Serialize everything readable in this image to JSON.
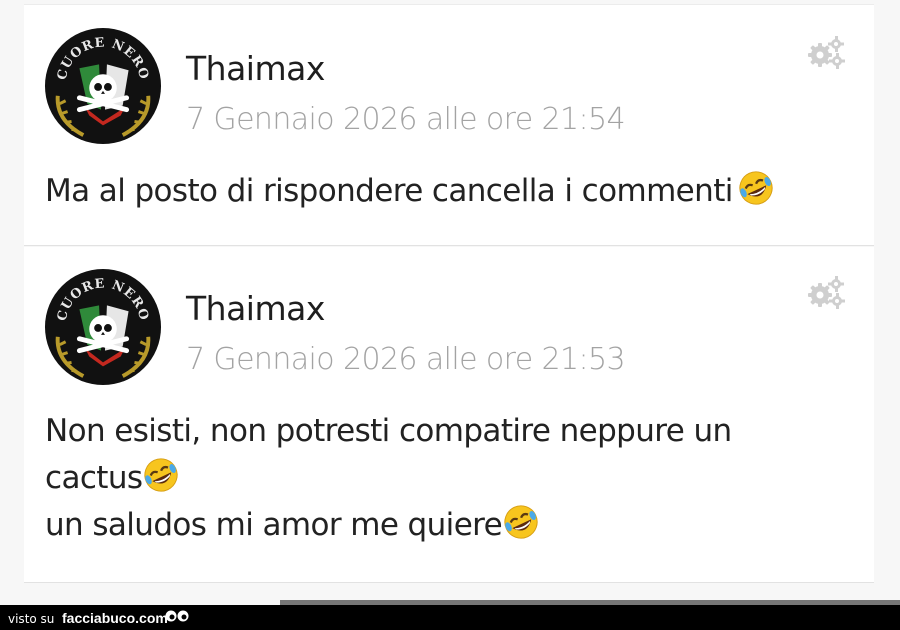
{
  "comments": [
    {
      "author": "Thaimax",
      "timestamp": "7 Gennaio 2026 alle ore 21:54",
      "lines": [
        "Ma al posto di rispondere cancella i commenti"
      ],
      "avatar_icon": "cuore-nero-skull-avatar",
      "settings_icon": "gears-icon"
    },
    {
      "author": "Thaimax",
      "timestamp": "7 Gennaio 2026 alle ore 21:53",
      "lines": [
        "Non esisti, non potresti compatire neppure un",
        "cactus",
        "un saludos mi amor me quiere"
      ],
      "avatar_icon": "cuore-nero-skull-avatar",
      "settings_icon": "gears-icon"
    }
  ],
  "avatar_text": "CUORE NERO",
  "footer": {
    "visto_su": "visto su",
    "brand": "facciabuco.com"
  },
  "colors": {
    "author": "#1e1e1e",
    "timestamp": "#a3a3a3",
    "text": "#222222",
    "avatar_bg": "#111111",
    "wreath": "#b89a2a"
  }
}
